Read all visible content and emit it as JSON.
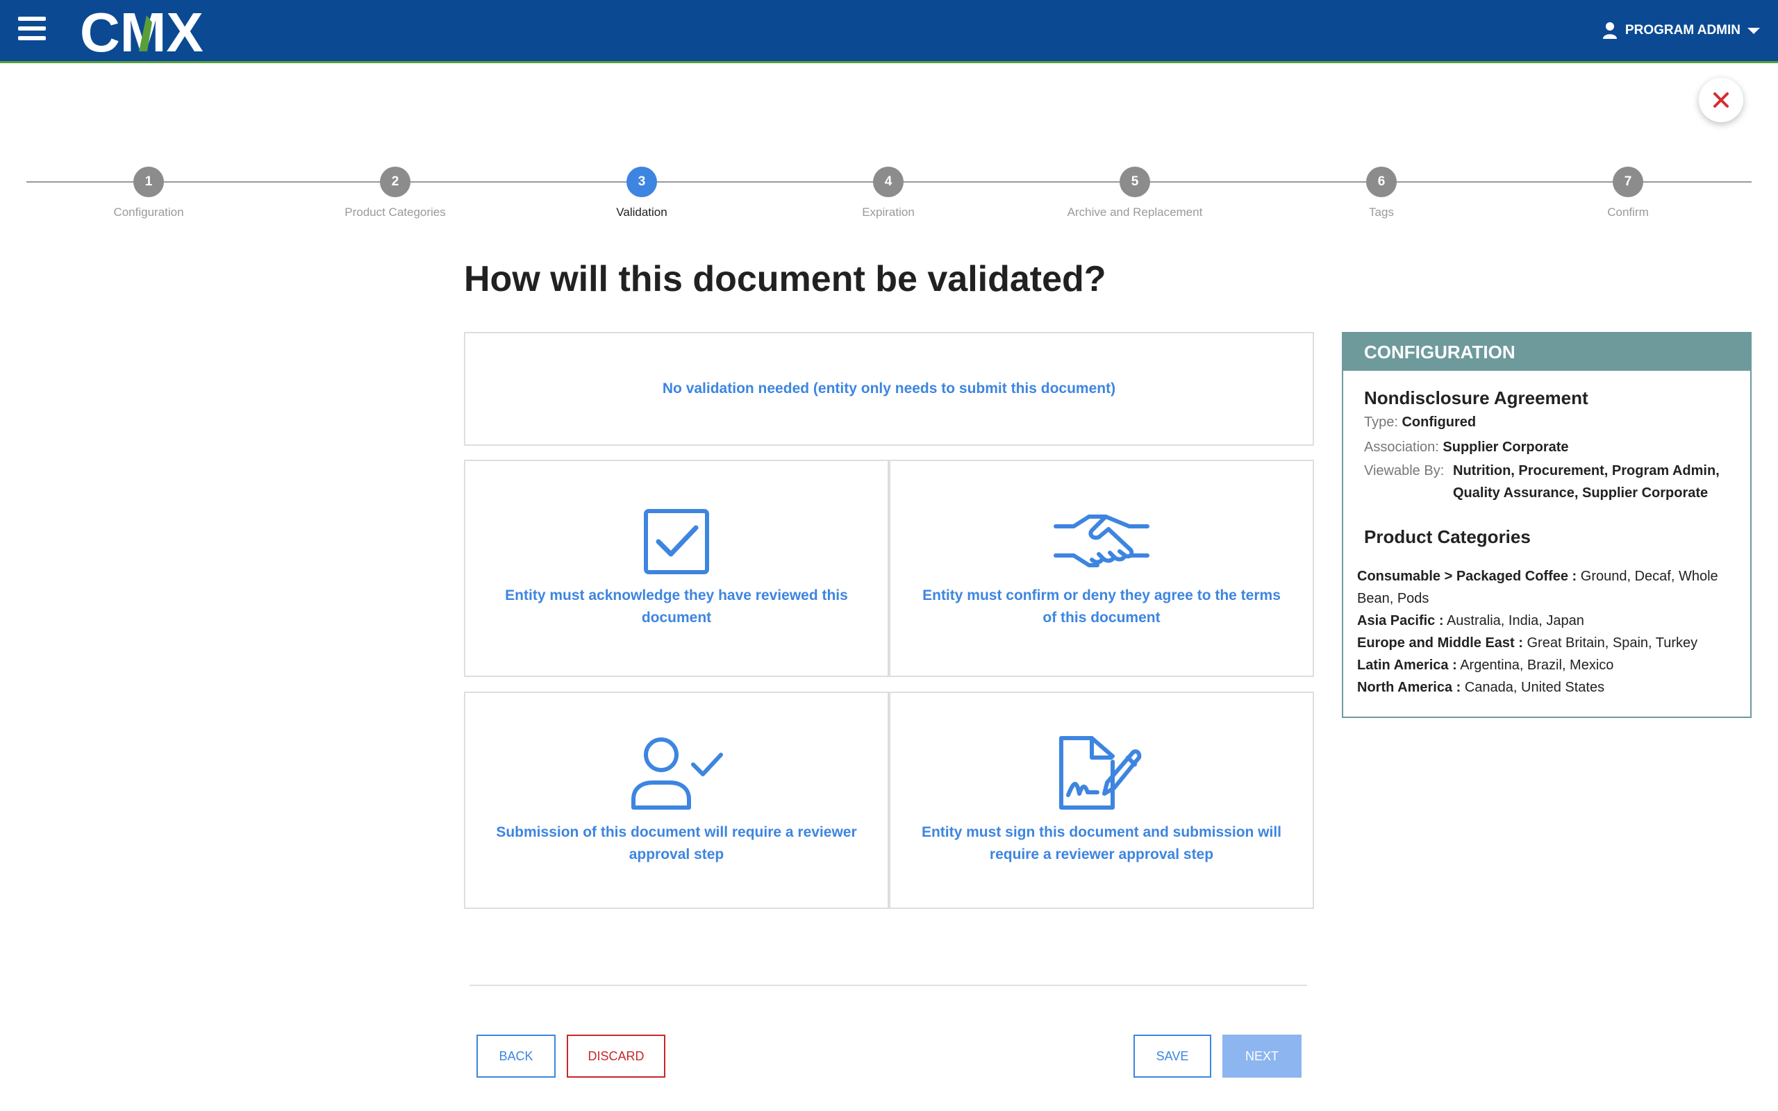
{
  "header": {
    "logo_text": "CMX",
    "user_label": "PROGRAM ADMIN",
    "brand_color": "#0b4a93",
    "accent_color": "#5a9e3a"
  },
  "stepper": {
    "steps": [
      {
        "number": "1",
        "label": "Configuration"
      },
      {
        "number": "2",
        "label": "Product Categories"
      },
      {
        "number": "3",
        "label": "Validation"
      },
      {
        "number": "4",
        "label": "Expiration"
      },
      {
        "number": "5",
        "label": "Archive and Replacement"
      },
      {
        "number": "6",
        "label": "Tags"
      },
      {
        "number": "7",
        "label": "Confirm"
      }
    ],
    "active_step": "3"
  },
  "main": {
    "title": "How will this document be validated?",
    "options": {
      "none": "No validation needed (entity only needs to submit this document)",
      "acknowledge": "Entity must acknowledge they have reviewed this document",
      "agree": "Entity must confirm or deny they agree to the terms of this document",
      "reviewer": "Submission of this document will require a reviewer approval step",
      "sign": "Entity must sign this document and submission will require a reviewer approval step"
    },
    "option_color": "#3d85e0"
  },
  "config": {
    "header": "CONFIGURATION",
    "doc_name": "Nondisclosure Agreement",
    "type_label": "Type:",
    "type_value": "Configured",
    "association_label": "Association:",
    "association_value": "Supplier Corporate",
    "viewable_label": "Viewable By:",
    "viewable_value": "Nutrition, Procurement, Program Admin, Quality Assurance, Supplier Corporate",
    "product_categories_title": "Product Categories",
    "categories": [
      {
        "key": "Consumable > Packaged Coffee :",
        "value": " Ground, Decaf, Whole Bean, Pods"
      },
      {
        "key": "Asia Pacific :",
        "value": " Australia, India, Japan"
      },
      {
        "key": "Europe and Middle East :",
        "value": " Great Britain, Spain, Turkey"
      },
      {
        "key": "Latin America :",
        "value": " Argentina, Brazil, Mexico"
      },
      {
        "key": "North America :",
        "value": " Canada, United States"
      }
    ],
    "panel_color": "#6f9a9c"
  },
  "footer": {
    "back": "BACK",
    "discard": "DISCARD",
    "save": "SAVE",
    "next": "NEXT"
  }
}
